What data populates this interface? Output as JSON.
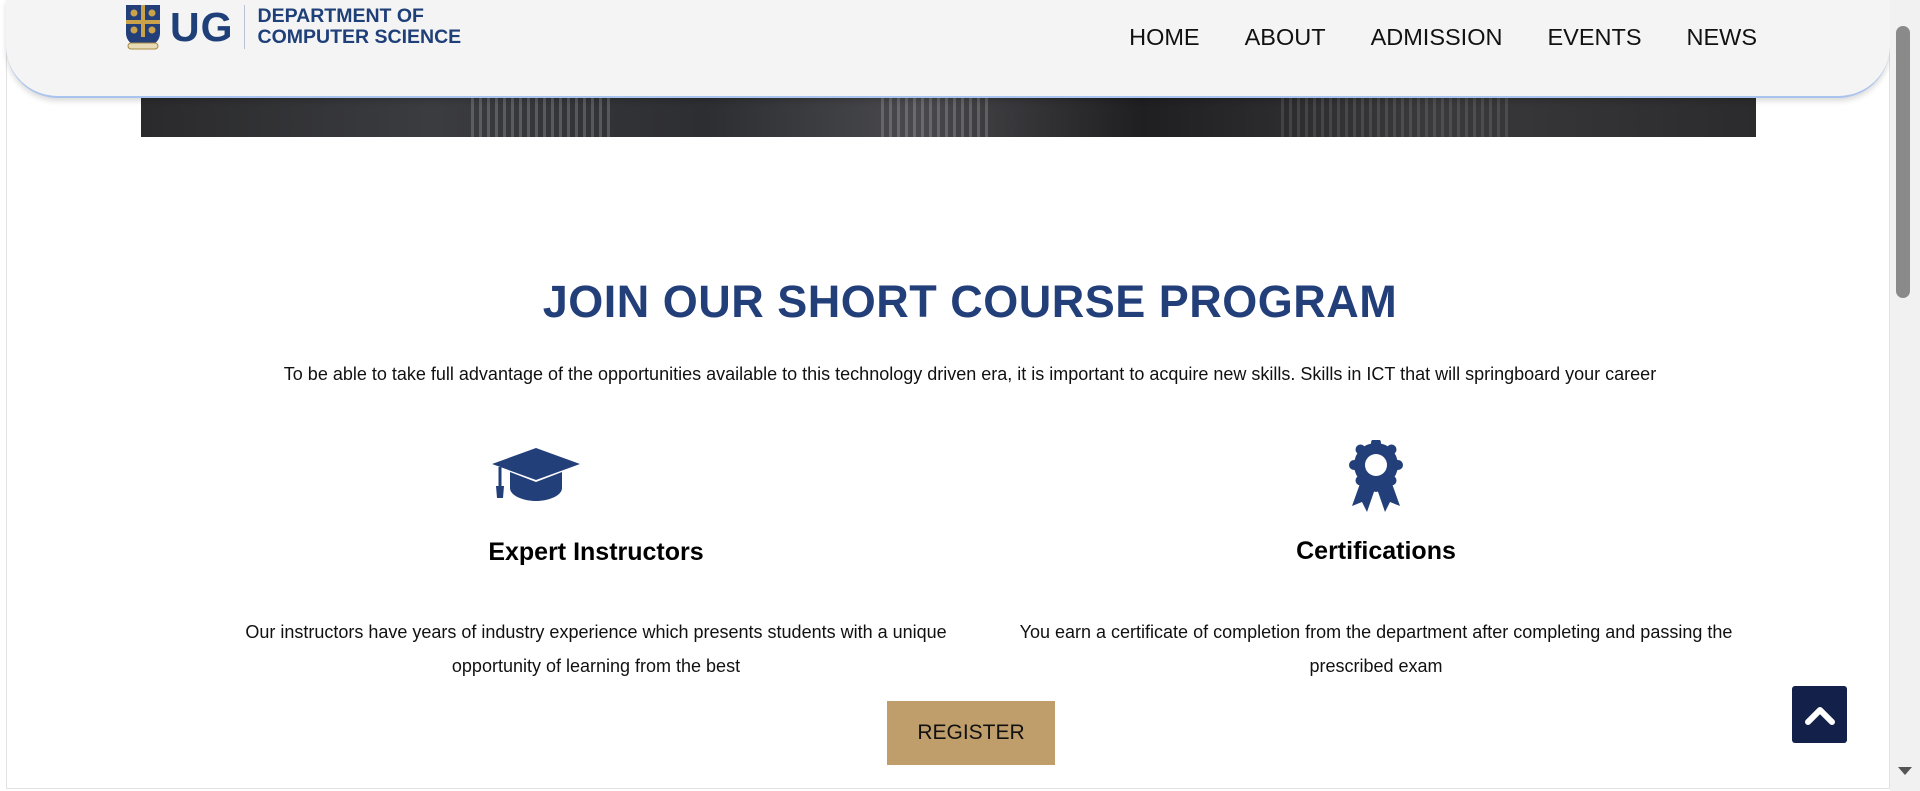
{
  "header": {
    "brand_short": "UG",
    "brand_line1": "DEPARTMENT OF",
    "brand_line2": "COMPUTER SCIENCE",
    "nav": [
      "HOME",
      "ABOUT",
      "ADMISSION",
      "EVENTS",
      "NEWS"
    ]
  },
  "section": {
    "title": "JOIN OUR SHORT COURSE PROGRAM",
    "lead": "To be able to take full advantage of the opportunities available to this technology driven era, it is important to acquire new skills. Skills in ICT that will springboard your career"
  },
  "features": [
    {
      "icon": "graduation-cap-icon",
      "title": "Expert Instructors",
      "text_line1": "Our instructors have years of industry experience which presents students with a unique",
      "text_line2": "opportunity of learning from the best"
    },
    {
      "icon": "award-ribbon-icon",
      "title": "Certifications",
      "text_line1": "You earn a certificate of completion from the department after completing and passing the",
      "text_line2": "prescribed exam"
    }
  ],
  "register_label": "REGISTER",
  "back_to_top_icon": "chevron-up-icon",
  "colors": {
    "brand_blue": "#233f7a",
    "register_gold": "#bf9e6c",
    "back_to_top_navy": "#13204a"
  }
}
